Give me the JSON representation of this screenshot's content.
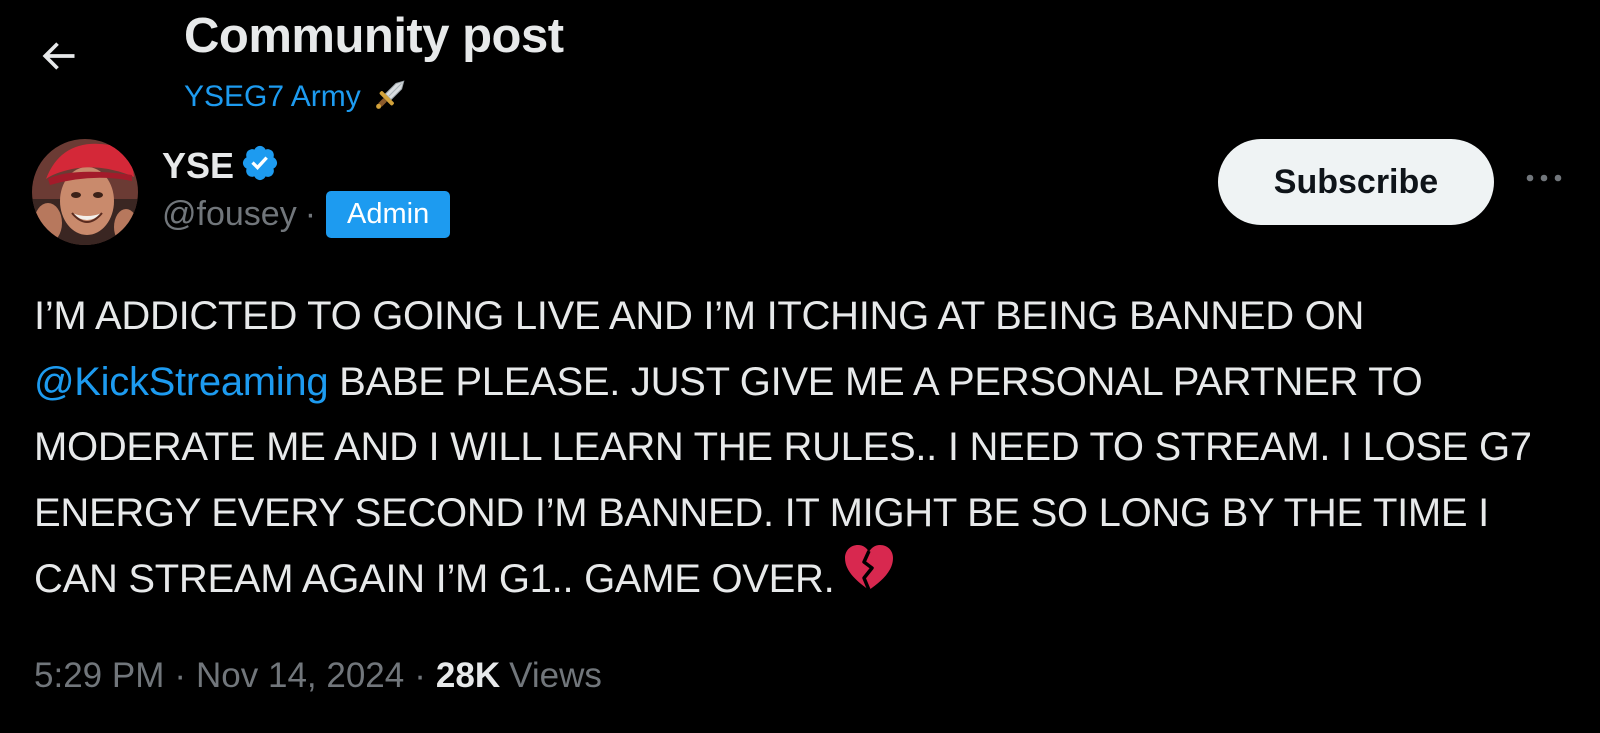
{
  "header": {
    "title": "Community post",
    "community_name": "YSEG7 Army",
    "community_emoji_icon": "dagger-icon"
  },
  "author": {
    "display_name": "YSE",
    "verified_icon": "verified-badge-icon",
    "handle": "@fousey",
    "separator": "·",
    "role_badge": "Admin"
  },
  "actions": {
    "subscribe_label": "Subscribe",
    "more_icon": "more-horizontal-icon"
  },
  "post": {
    "text_before_mention": "I’M ADDICTED TO GOING LIVE AND I’M ITCHING AT BEING BANNED ON ",
    "mention": "@KickStreaming",
    "text_after_mention": " BABE PLEASE. JUST GIVE ME A PERSONAL PARTNER TO MODERATE ME AND I WILL LEARN THE RULES.. I NEED TO STREAM. I LOSE G7 ENERGY EVERY SECOND I’M BANNED. IT MIGHT BE SO LONG BY THE TIME I CAN STREAM AGAIN I’M G1.. GAME OVER.",
    "trailing_emoji_icon": "broken-heart-icon"
  },
  "meta": {
    "time": "5:29 PM",
    "separator": "·",
    "date": "Nov 14, 2024",
    "views_count": "28K",
    "views_label": "Views"
  },
  "colors": {
    "background": "#000000",
    "text_primary": "#e7e9ea",
    "text_secondary": "#71767b",
    "accent": "#1d9bf0",
    "subscribe_bg": "#eff3f4",
    "broken_heart": "#d8284f"
  }
}
